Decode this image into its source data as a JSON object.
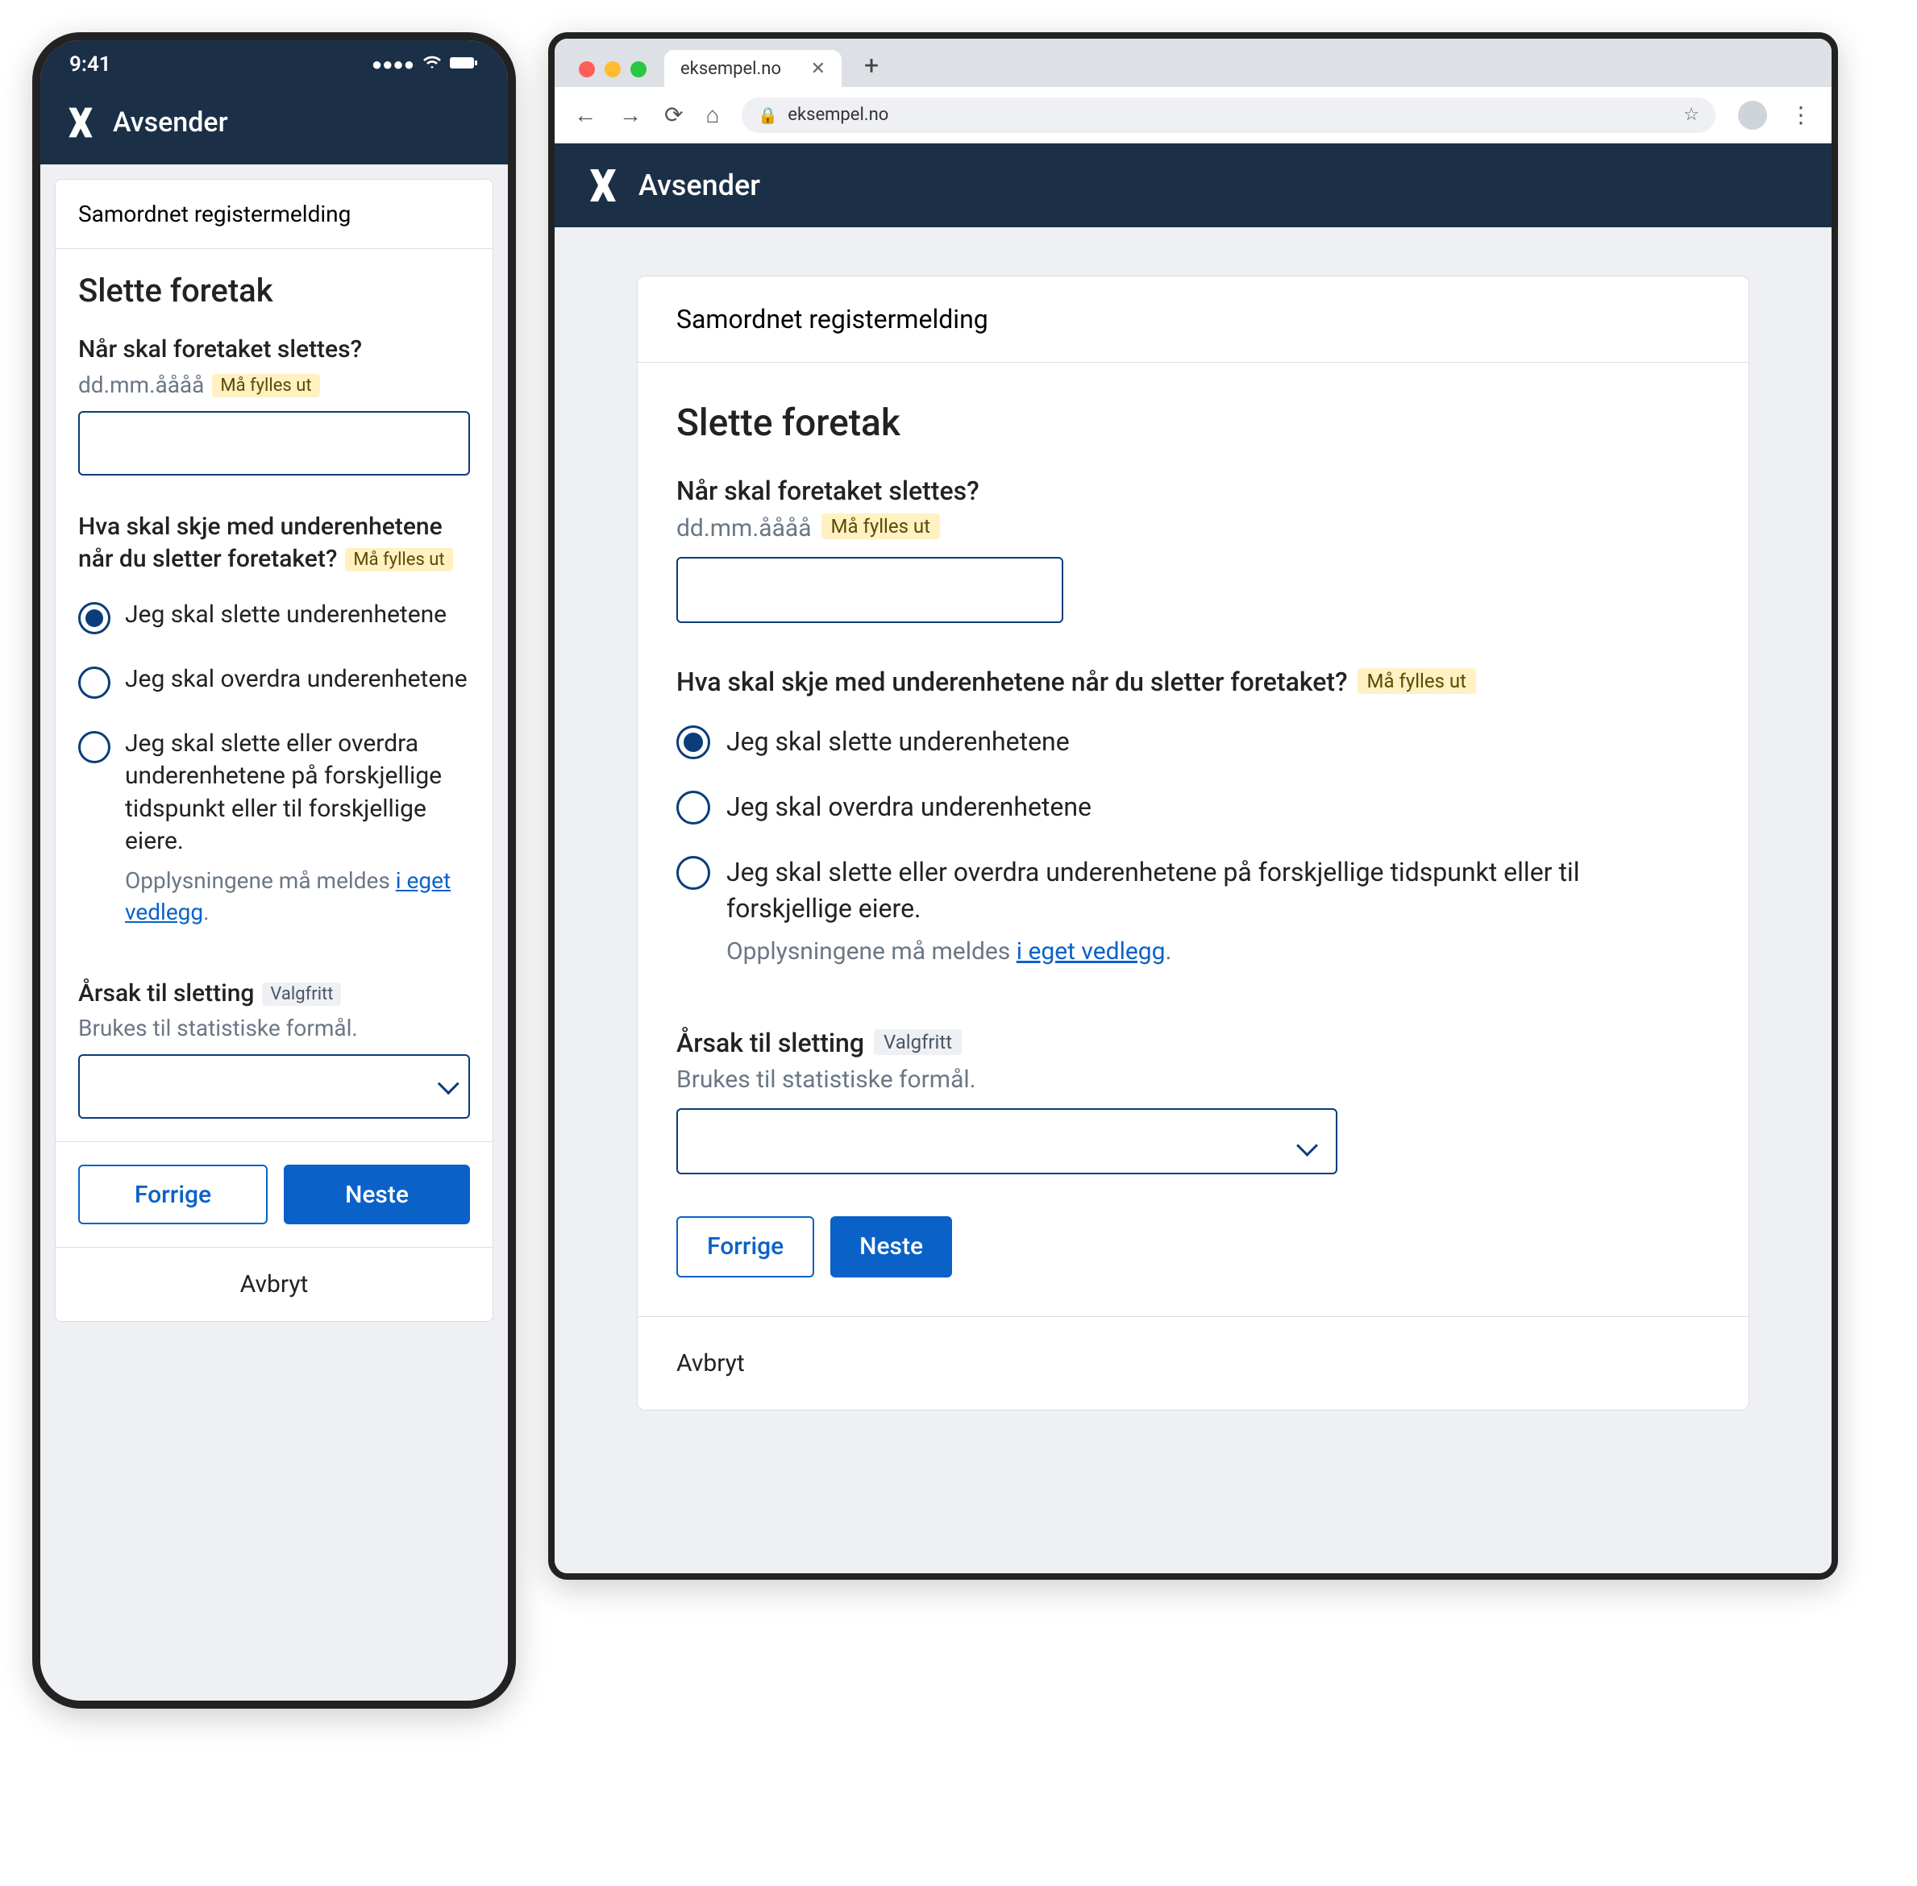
{
  "status_time": "9:41",
  "brand": "Avsender",
  "browser": {
    "tab_title": "eksempel.no",
    "url": "eksempel.no"
  },
  "card_header": "Samordnet registermelding",
  "page_title": "Slette foretak",
  "date_field": {
    "label": "Når skal foretaket slettes?",
    "format_hint": "dd.mm.åååå",
    "required_tag": "Må fylles ut"
  },
  "subunits_field": {
    "label": "Hva skal skje med underenhetene når du sletter foretaket?",
    "required_tag": "Må fylles ut",
    "options": [
      {
        "label": "Jeg skal slette underenhetene"
      },
      {
        "label": "Jeg skal overdra underenhetene"
      },
      {
        "label": "Jeg skal slette eller overdra underenhetene på forskjellige tidspunkt eller til forskjellige eiere.",
        "desc_prefix": "Opplysningene må meldes ",
        "desc_link": "i eget vedlegg",
        "desc_suffix": "."
      }
    ]
  },
  "reason_field": {
    "label": "Årsak til sletting",
    "optional_tag": "Valgfritt",
    "help": "Brukes til statistiske formål."
  },
  "buttons": {
    "prev": "Forrige",
    "next": "Neste",
    "cancel": "Avbryt"
  }
}
